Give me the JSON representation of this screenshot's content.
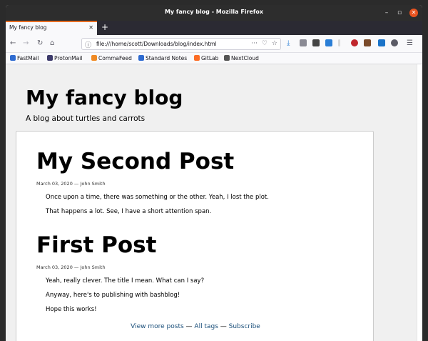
{
  "window": {
    "title": "My fancy blog - Mozilla Firefox",
    "minimize": "–",
    "maximize": "▫",
    "close": "✕"
  },
  "tab": {
    "label": "My fancy blog",
    "close": "✕",
    "new": "+"
  },
  "nav": {
    "back": "←",
    "forward": "→",
    "reload": "↻",
    "home": "⌂",
    "url": "file:///home/scott/Downloads/blog/index.html",
    "more": "···",
    "pocket": "♡",
    "bookmark": "☆",
    "download": "⤓",
    "menu": "☰"
  },
  "bookmarks": [
    {
      "label": "FastMail",
      "color": "#2f6bd0"
    },
    {
      "label": "ProtonMail",
      "color": "#3d3a6b"
    },
    {
      "label": "CommaFeed",
      "color": "#f08a24"
    },
    {
      "label": "Standard Notes",
      "color": "#2f6bd0"
    },
    {
      "label": "GitLab",
      "color": "#fc6d26"
    },
    {
      "label": "NextCloud",
      "color": "#555555"
    }
  ],
  "blog": {
    "title": "My fancy blog",
    "subtitle": "A blog about turtles and carrots"
  },
  "posts": [
    {
      "title": "My Second Post",
      "meta": "March 03, 2020 — John Smith",
      "lines": [
        "Once upon a time, there was something or the other. Yeah, I lost the plot.",
        "That happens a lot. See, I have a short attention span."
      ]
    },
    {
      "title": "First Post",
      "meta": "March 03, 2020 — John Smith",
      "lines": [
        "Yeah, really clever. The title I mean. What can I say?",
        "Anyway, here's to publishing with bashblog!",
        "Hope this works!"
      ]
    }
  ],
  "footer": {
    "more_posts": "View more posts",
    "sep1": " — ",
    "all_tags": "All tags",
    "sep2": " — ",
    "subscribe": "Subscribe"
  }
}
